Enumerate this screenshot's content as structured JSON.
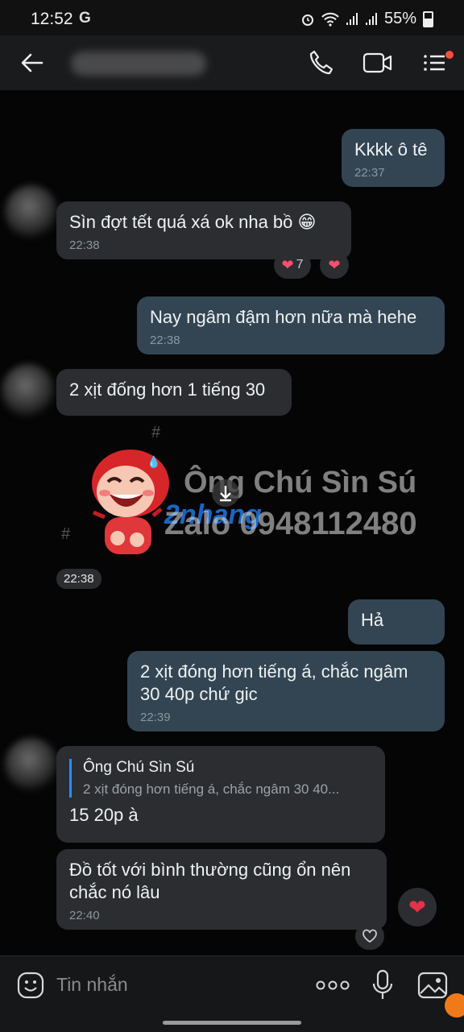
{
  "status_bar": {
    "time": "12:52",
    "g_label": "G",
    "battery": "55%"
  },
  "header": {
    "back_icon": "arrow-left-icon",
    "icons": [
      "phone-icon",
      "video-call-icon",
      "menu-icon"
    ],
    "notification_dot_color": "#ff4d3d"
  },
  "messages": [
    {
      "text": "Kkkk ô tê",
      "time": "22:37"
    },
    {
      "text": "Sìn đợt tết quá xá ok nha bồ 😁",
      "time": "22:38",
      "reaction_count": "7"
    },
    {
      "text": "Nay ngâm đậm hơn nữa mà hehe",
      "time": "22:38"
    },
    {
      "text": "2 xịt đống hơn 1 tiếng 30"
    },
    {
      "time": "22:38",
      "watermark_title": "Ông Chú Sìn Sú",
      "watermark_phone": "Zalo 0948112480",
      "watermark_logo": "2nhang"
    },
    {
      "text": "Hả"
    },
    {
      "text": "2 xịt đóng hơn tiếng á, chắc ngâm\n30 40p chứ gic",
      "time": "22:39"
    },
    {
      "quote_name": "Ông Chú Sìn Sú",
      "quote_text": "2 xịt đóng hơn tiếng á, chắc ngâm 30 40...",
      "text": "15 20p à"
    },
    {
      "text": "Đồ tốt với bình thường cũng ổn nên\nchắc nó lâu",
      "time": "22:40"
    }
  ],
  "composer": {
    "placeholder": "Tin nhắn"
  },
  "colors": {
    "outgoing_bubble": "#334552",
    "incoming_bubble": "#2b2d30",
    "accent": "#2d8cf0",
    "heart": "#ff4d6d"
  }
}
